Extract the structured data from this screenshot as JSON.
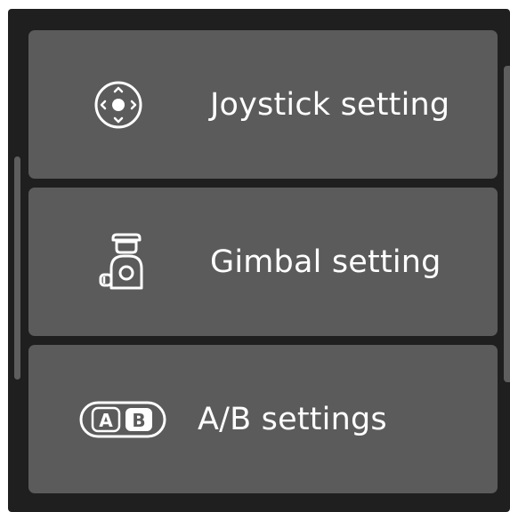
{
  "menu": {
    "items": [
      {
        "label": "Joystick setting",
        "icon": "joystick-icon"
      },
      {
        "label": "Gimbal setting",
        "icon": "gimbal-icon"
      },
      {
        "label": "A/B settings",
        "icon": "ab-buttons-icon"
      }
    ]
  },
  "colors": {
    "background": "#1f1f1f",
    "card": "#5b5b5b",
    "text": "#ffffff",
    "scrollbar": "#5e5e5e"
  },
  "icons": {
    "ab_left_letter": "A",
    "ab_right_letter": "B"
  }
}
